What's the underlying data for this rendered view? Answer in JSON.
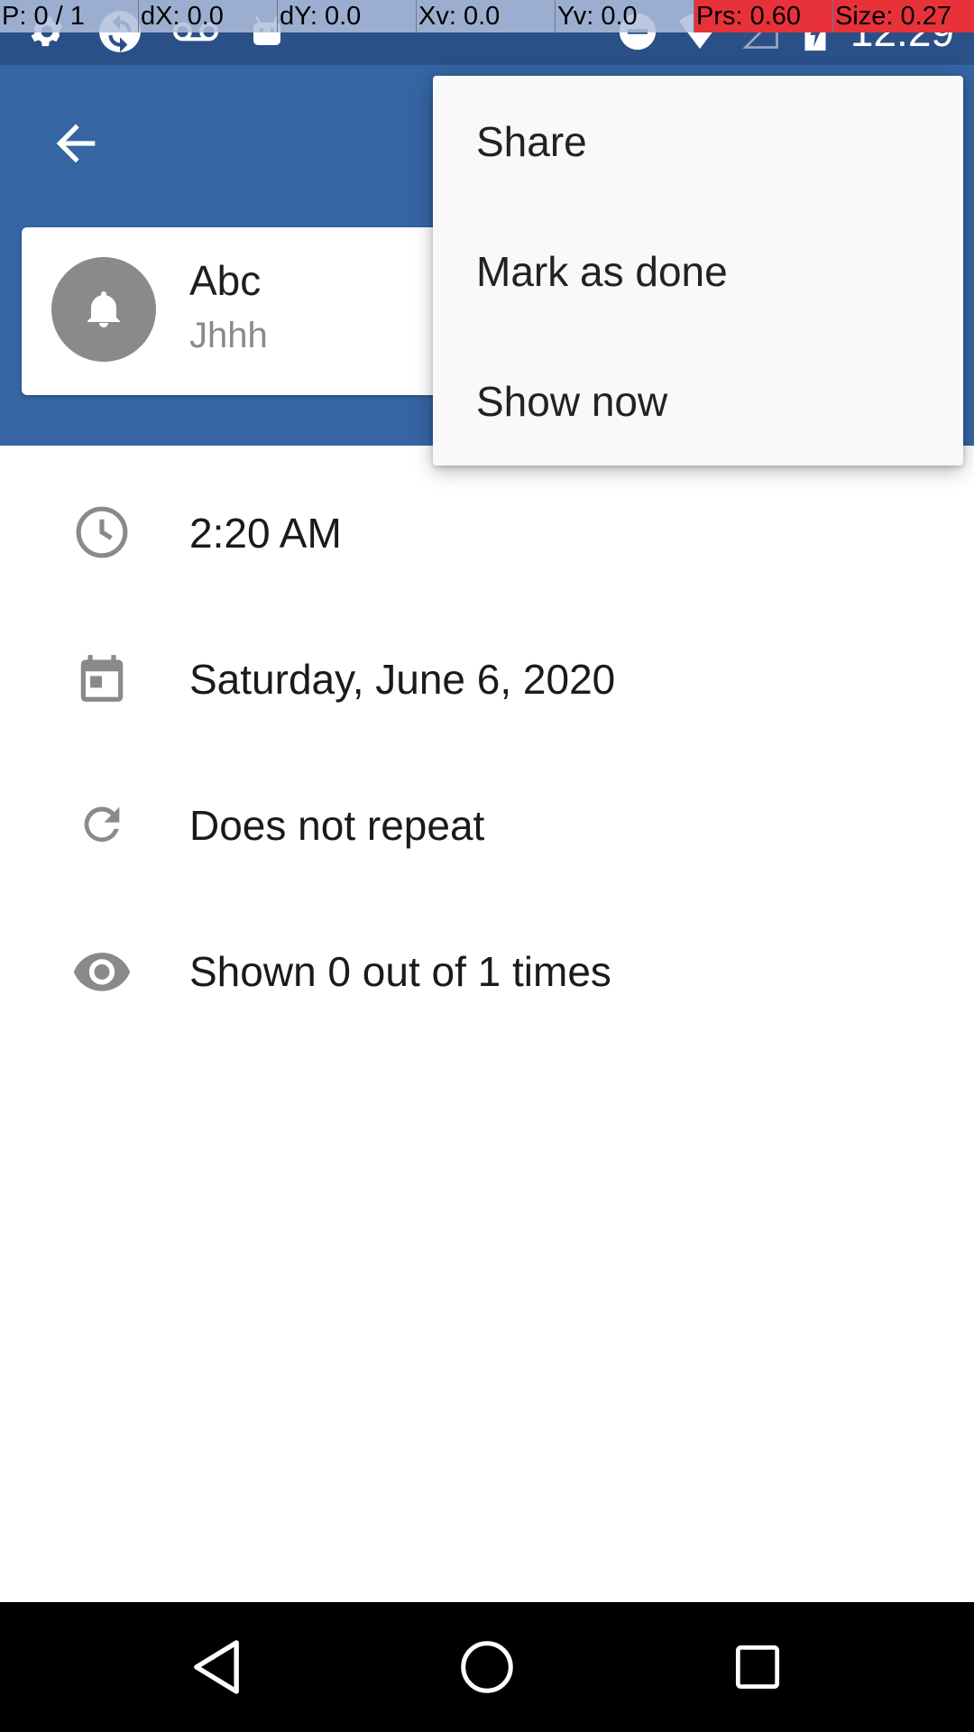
{
  "status_bar": {
    "time": "12:29",
    "left_icons": [
      "settings-icon",
      "sync-icon",
      "voicemail-icon",
      "android-icon"
    ],
    "right_icons": [
      "do-not-disturb-icon",
      "wifi-icon",
      "signal-icon",
      "battery-charging-icon"
    ]
  },
  "pointer_overlay": {
    "p": "P: 0 / 1",
    "dx": "dX: 0.0",
    "dy": "dY: 0.0",
    "xv": "Xv: 0.0",
    "yv": "Yv: 0.0",
    "prs": "Prs: 0.60",
    "size": "Size: 0.27"
  },
  "header": {
    "back_icon": "arrow-back-icon",
    "reminder": {
      "title": "Abc",
      "subtitle": "Jhhh",
      "avatar_icon": "bell-icon"
    }
  },
  "details": [
    {
      "icon": "clock-icon",
      "text": "2:20 AM"
    },
    {
      "icon": "calendar-icon",
      "text": "Saturday, June 6, 2020"
    },
    {
      "icon": "repeat-icon",
      "text": "Does not repeat"
    },
    {
      "icon": "eye-icon",
      "text": "Shown 0 out of 1 times"
    }
  ],
  "menu": {
    "items": [
      {
        "label": "Share"
      },
      {
        "label": "Mark as done"
      },
      {
        "label": "Show now"
      }
    ]
  },
  "nav_bar": {
    "icons": [
      "back-triangle-icon",
      "home-circle-icon",
      "recents-square-icon"
    ]
  },
  "colors": {
    "status_bar": "#2b5088",
    "app_bar": "#3565a3",
    "menu_bg": "#f9f9f9",
    "icon_gray": "#8a8a8a"
  }
}
